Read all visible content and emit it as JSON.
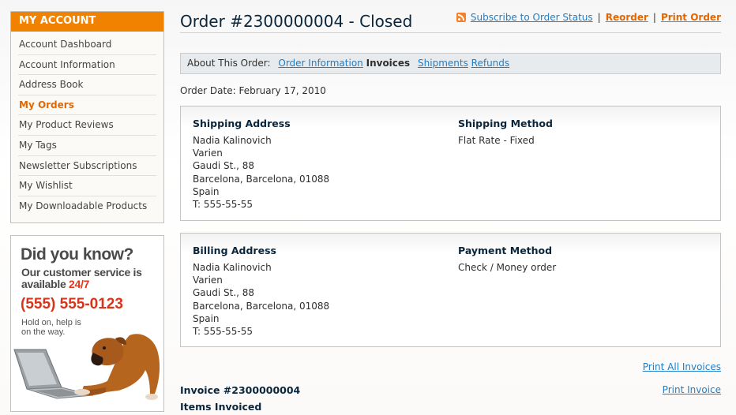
{
  "sidebar": {
    "heading": "MY ACCOUNT",
    "items": [
      {
        "label": "Account Dashboard"
      },
      {
        "label": "Account Information"
      },
      {
        "label": "Address Book"
      },
      {
        "label": "My Orders"
      },
      {
        "label": "My Product Reviews"
      },
      {
        "label": "My Tags"
      },
      {
        "label": "Newsletter Subscriptions"
      },
      {
        "label": "My Wishlist"
      },
      {
        "label": "My Downloadable Products"
      }
    ],
    "current_item": "My Orders"
  },
  "promo": {
    "line1": "Did you know?",
    "line2": "Our customer service is available",
    "line2_highlight": "24/7",
    "phone": "(555) 555-0123",
    "line3": "Hold on, help is on the way.",
    "image": "dog-with-laptop"
  },
  "header": {
    "title": "Order #2300000004 - Closed",
    "subscribe_label": "Subscribe to Order Status",
    "reorder_label": "Reorder",
    "print_order_label": "Print Order",
    "separator": "|",
    "rss_icon": "rss-icon"
  },
  "tabs": {
    "prefix": "About This Order:",
    "items": [
      {
        "label": "Order Information",
        "active": false
      },
      {
        "label": "Invoices",
        "active": true
      },
      {
        "label": "Shipments",
        "active": false
      },
      {
        "label": "Refunds",
        "active": false
      }
    ]
  },
  "order_date": "Order Date: February 17, 2010",
  "shipping": {
    "address_title": "Shipping Address",
    "address_lines": [
      "Nadia Kalinovich",
      "Varien",
      "Gaudi St., 88",
      "Barcelona, Barcelona, 01088",
      "Spain",
      "T: 555-55-55"
    ],
    "method_title": "Shipping Method",
    "method": "Flat Rate - Fixed"
  },
  "billing": {
    "address_title": "Billing Address",
    "address_lines": [
      "Nadia Kalinovich",
      "Varien",
      "Gaudi St., 88",
      "Barcelona, Barcelona, 01088",
      "Spain",
      "T: 555-55-55"
    ],
    "method_title": "Payment Method",
    "method": "Check / Money order"
  },
  "invoice": {
    "print_all_label": "Print All Invoices",
    "title": "Invoice #2300000004",
    "print_label": "Print Invoice",
    "items_title": "Items Invoiced"
  },
  "colors": {
    "accent_orange": "#f18200",
    "link_blue": "#1e7ec8",
    "title_navy": "#0a263c"
  }
}
